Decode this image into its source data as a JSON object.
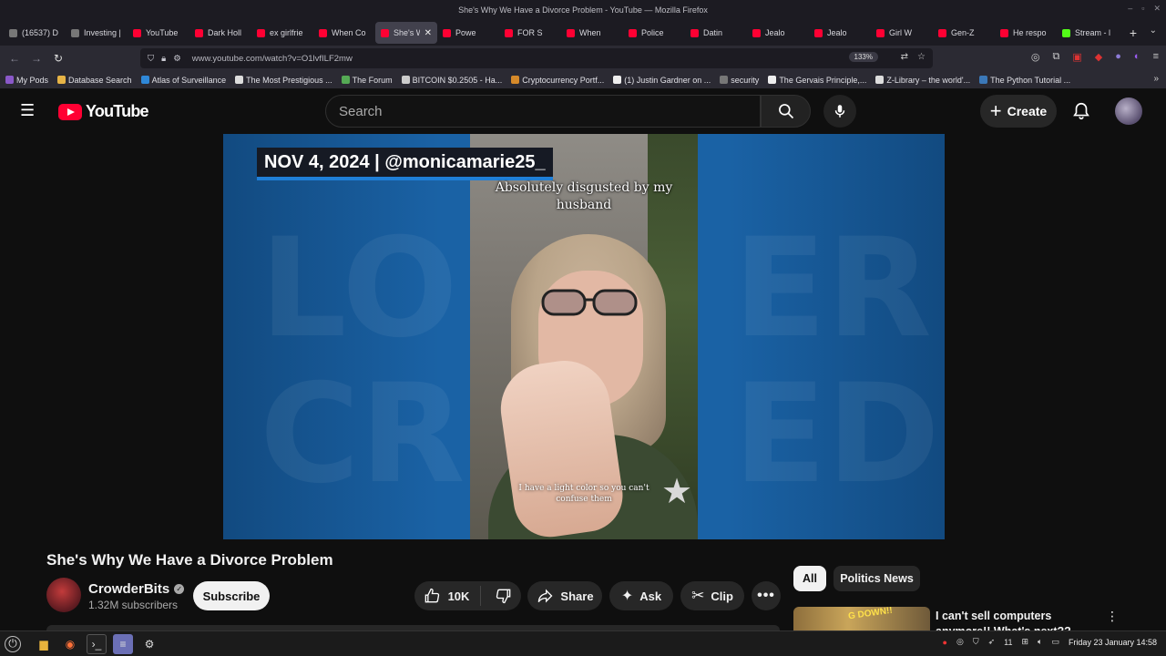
{
  "window": {
    "title": "She's Why We Have a Divorce Problem - YouTube — Mozilla Firefox"
  },
  "tabs": [
    {
      "label": "(16537) D",
      "fav": "g"
    },
    {
      "label": "Investing | Re",
      "fav": "g"
    },
    {
      "label": "YouTube",
      "fav": "r"
    },
    {
      "label": "Dark Holl",
      "fav": "r"
    },
    {
      "label": "ex girlfrie",
      "fav": "r"
    },
    {
      "label": "When Co",
      "fav": "r"
    },
    {
      "label": "She's W",
      "fav": "r",
      "active": true
    },
    {
      "label": "Powe",
      "fav": "r"
    },
    {
      "label": "FOR S",
      "fav": "r"
    },
    {
      "label": "When",
      "fav": "r"
    },
    {
      "label": "Police",
      "fav": "r"
    },
    {
      "label": "Datin",
      "fav": "r"
    },
    {
      "label": "Jealo",
      "fav": "r"
    },
    {
      "label": "Jealo",
      "fav": "r"
    },
    {
      "label": "Girl W",
      "fav": "r"
    },
    {
      "label": "Gen-Z",
      "fav": "r"
    },
    {
      "label": "He respo",
      "fav": "r"
    },
    {
      "label": "Stream - l",
      "fav": "k"
    }
  ],
  "addressbar": {
    "url": "www.youtube.com/watch?v=O1lvfILF2mw",
    "zoom": "133%"
  },
  "bookmarks": [
    "My Pods",
    "Database Search",
    "Atlas of Surveillance",
    "The Most Prestigious ...",
    "The Forum",
    "BITCOIN $0.2505 - Ha...",
    "Cryptocurrency Portf...",
    "(1) Justin Gardner on ...",
    "security",
    "The Gervais Principle,...",
    "Z-Library – the world'...",
    "The Python Tutorial ..."
  ],
  "header": {
    "logo_text": "YouTube",
    "search_placeholder": "Search",
    "create_label": "Create"
  },
  "video": {
    "banner": "NOV 4, 2024 | @monicamarie25_",
    "caption_top": "Absolutely disgusted by my husband",
    "caption_bottom": "I have a light color so you can't confuse them"
  },
  "meta": {
    "title": "She's Why We Have a Divorce Problem",
    "channel": "CrowderBits",
    "subscribers": "1.32M subscribers",
    "subscribe_label": "Subscribe",
    "likes": "10K",
    "share_label": "Share",
    "ask_label": "Ask",
    "clip_label": "Clip"
  },
  "sidebar": {
    "chips": [
      "All",
      "Politics News"
    ],
    "rec_title": "I can't sell computers anymore!! What's next??",
    "rec_thumb_text": "G DOWN!!"
  },
  "taskbar": {
    "tray_count": "11",
    "clock": "Friday 23 January 14:58"
  },
  "colors": {
    "yt_red": "#ff0033",
    "bg": "#0f0f0f",
    "accent_blue": "#1f7fd8"
  }
}
